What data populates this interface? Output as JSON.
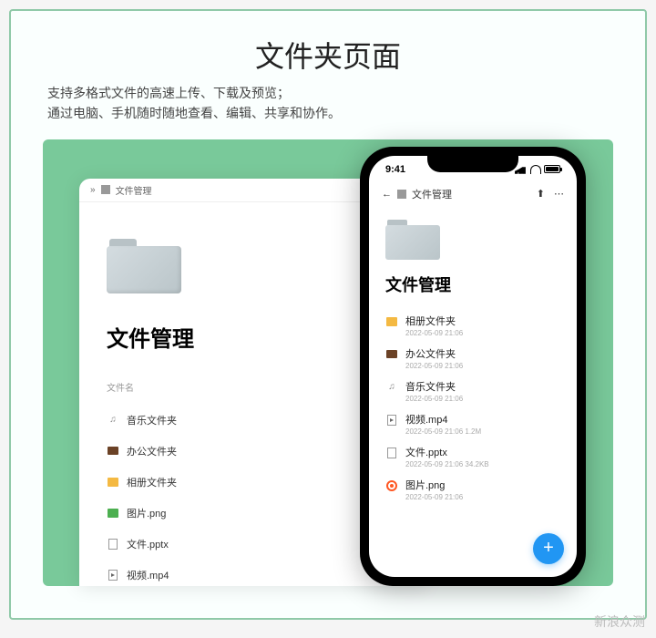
{
  "header": {
    "title": "文件夹页面",
    "desc_line1": "支持多格式文件的高速上传、下载及预览；",
    "desc_line2": "通过电脑、手机随时随地查看、编辑、共享和协作。"
  },
  "desktop": {
    "breadcrumb": "文件管理",
    "heading": "文件管理",
    "column_label": "文件名",
    "rows": [
      {
        "icon": "music",
        "name": "音乐文件夹"
      },
      {
        "icon": "briefcase",
        "name": "办公文件夹"
      },
      {
        "icon": "photo",
        "name": "相册文件夹"
      },
      {
        "icon": "img",
        "name": "图片.png"
      },
      {
        "icon": "doc",
        "name": "文件.pptx"
      },
      {
        "icon": "vid",
        "name": "视频.mp4"
      }
    ]
  },
  "phone": {
    "time": "9:41",
    "nav": {
      "back": "←",
      "breadcrumb": "文件管理",
      "share": "⬆",
      "more": "⋯"
    },
    "heading": "文件管理",
    "rows": [
      {
        "icon": "photo",
        "name": "相册文件夹",
        "meta": "2022-05-09 21:06"
      },
      {
        "icon": "briefcase",
        "name": "办公文件夹",
        "meta": "2022-05-09 21:06"
      },
      {
        "icon": "music",
        "name": "音乐文件夹",
        "meta": "2022-05-09 21:06"
      },
      {
        "icon": "vid",
        "name": "视频.mp4",
        "meta": "2022-05-09 21:06   1.2M"
      },
      {
        "icon": "doc",
        "name": "文件.pptx",
        "meta": "2022-05-09 21:06   34.2KB"
      },
      {
        "icon": "target",
        "name": "图片.png",
        "meta": "2022-05-09 21:06"
      }
    ],
    "fab": "+"
  },
  "watermark": "新浪众测"
}
